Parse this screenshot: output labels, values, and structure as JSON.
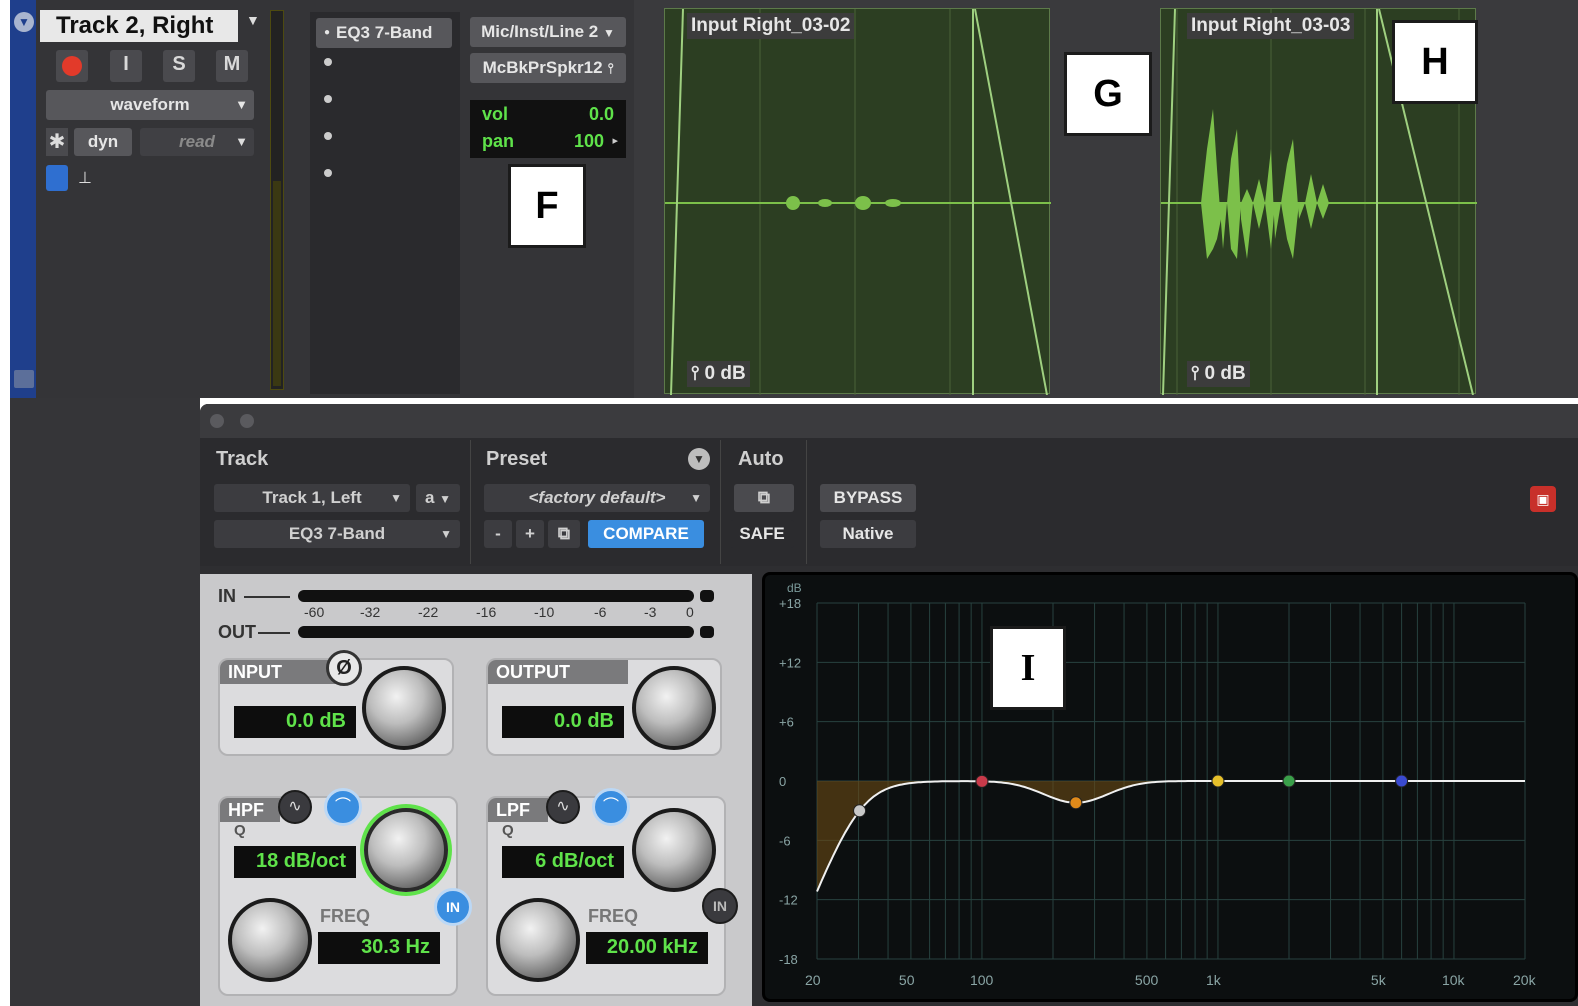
{
  "track": {
    "name": "Track 2, Right",
    "record_btn": "",
    "input_btn": "I",
    "solo_btn": "S",
    "mute_btn": "M",
    "view_select": "waveform",
    "dyn_label": "dyn",
    "automation_mode": "read",
    "inserts": [
      "EQ3 7-Band",
      "",
      "",
      "",
      ""
    ],
    "io_input": "Mic/Inst/Line 2",
    "io_output": "McBkPrSpkr12",
    "vol_label": "vol",
    "vol_value": "0.0",
    "pan_label": "pan",
    "pan_value": "100"
  },
  "clips": [
    {
      "name": "Input Right_03-02",
      "gain": "0 dB"
    },
    {
      "name": "Input Right_03-03",
      "gain": "0 dB"
    }
  ],
  "annotations": {
    "F": "F",
    "G": "G",
    "H": "H",
    "I": "I"
  },
  "plugin": {
    "track_header": "Track",
    "preset_header": "Preset",
    "auto_header": "Auto",
    "track_select": "Track 1, Left",
    "track_variant": "a",
    "plugin_select": "EQ3 7-Band",
    "preset_select": "<factory default>",
    "preset_minus": "-",
    "preset_plus": "+",
    "compare_btn": "COMPARE",
    "bypass_btn": "BYPASS",
    "safe_btn": "SAFE",
    "native_label": "Native",
    "meter_in_label": "IN",
    "meter_out_label": "OUT",
    "meter_ticks": [
      "-60",
      "-32",
      "-22",
      "-16",
      "-10",
      "-6",
      "-3",
      "0"
    ],
    "input_label": "INPUT",
    "input_value": "0.0 dB",
    "phase_symbol": "Ø",
    "output_label": "OUTPUT",
    "output_value": "0.0 dB",
    "hpf_label": "HPF",
    "hpf_q_label": "Q",
    "hpf_q_value": "18 dB/oct",
    "hpf_freq_label": "FREQ",
    "hpf_freq_value": "30.3 Hz",
    "hpf_in_label": "IN",
    "lpf_label": "LPF",
    "lpf_q_label": "Q",
    "lpf_q_value": "6 dB/oct",
    "lpf_freq_label": "FREQ",
    "lpf_freq_value": "20.00 kHz",
    "lpf_in_label": "IN"
  },
  "eq_graph": {
    "db_unit": "dB",
    "y_ticks": [
      "+18",
      "+12",
      "+6",
      "0",
      "-6",
      "-12",
      "-18"
    ],
    "x_ticks": [
      "20",
      "50",
      "100",
      "500",
      "1k",
      "5k",
      "10k",
      "20k"
    ],
    "band_colors": [
      "#c8c8c8",
      "#c83a4a",
      "#e08a1a",
      "#e6c02a",
      "#3aa04a",
      "#3a4ad0"
    ]
  },
  "colors": {
    "accent_blue": "#3a8ee0",
    "lcd_green": "#5fe24a",
    "record_red": "#e23a2a",
    "clip_wave": "#7cc04a"
  }
}
